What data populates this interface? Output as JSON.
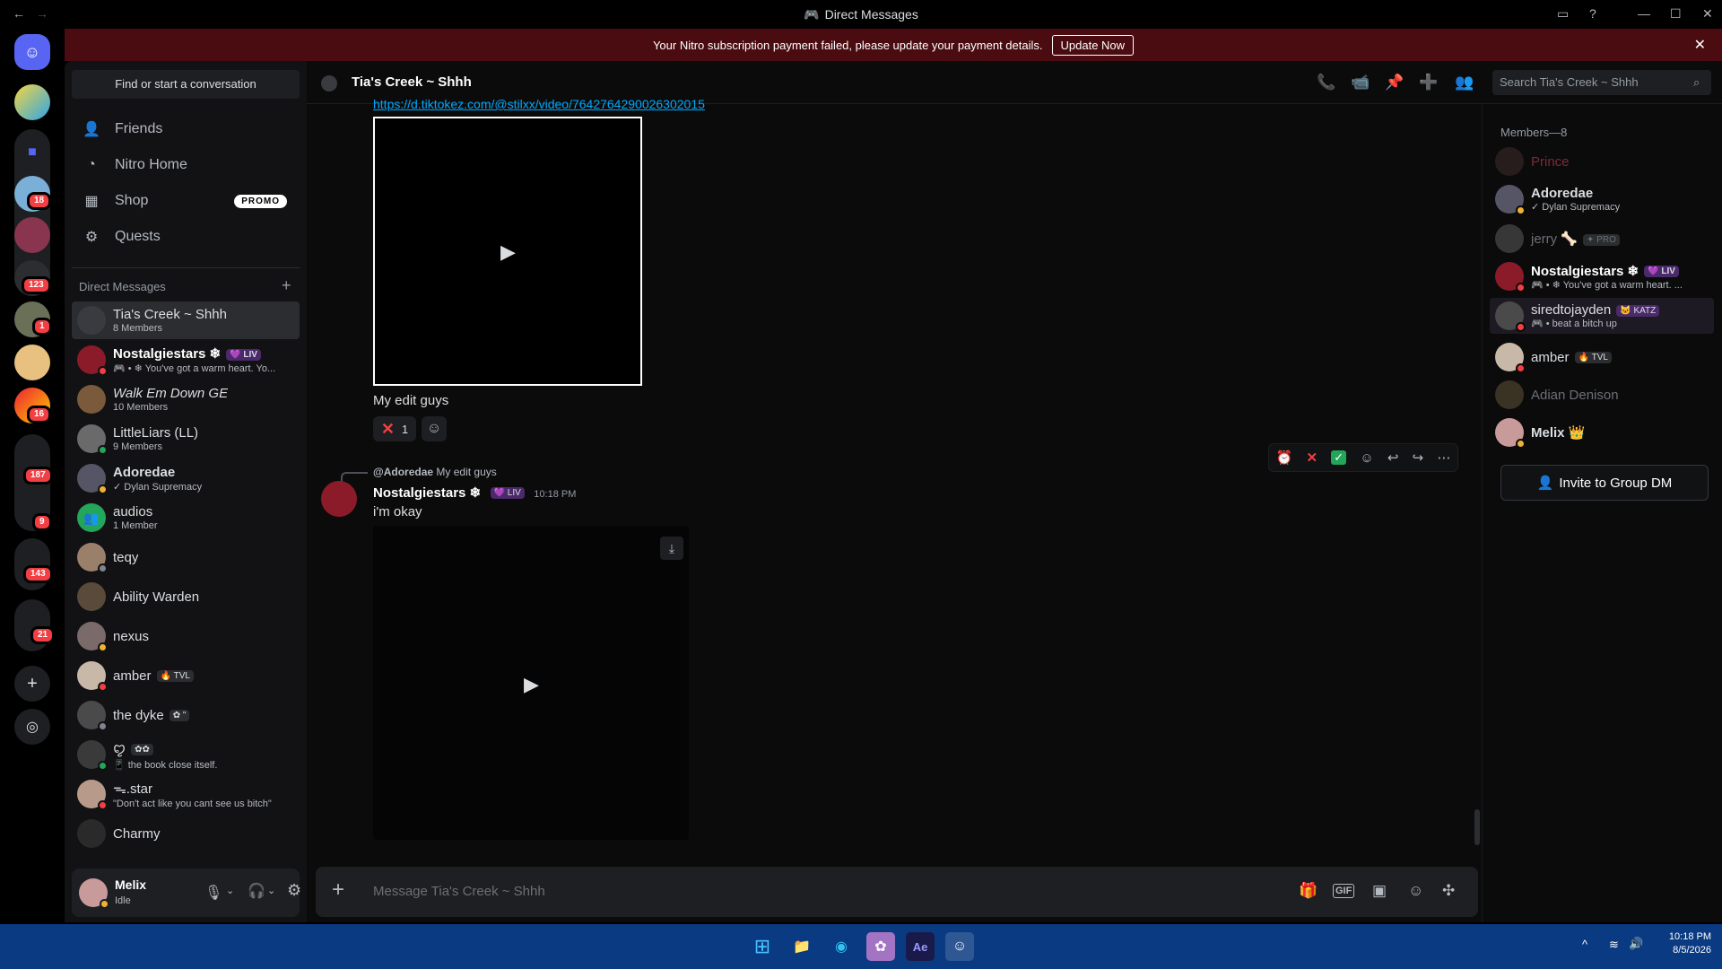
{
  "window": {
    "title": "Direct Messages",
    "back": "←",
    "forward": "→"
  },
  "banner": {
    "text": "Your Nitro subscription payment failed, please update your payment details.",
    "button": "Update Now"
  },
  "rail_badges": [
    "18",
    "123",
    "1",
    "16",
    "187",
    "9",
    "143",
    "21"
  ],
  "sidebar": {
    "find": "Find or start a conversation",
    "nav": [
      {
        "label": "Friends",
        "icon": "friends-icon"
      },
      {
        "label": "Nitro Home",
        "icon": "nitro-icon"
      },
      {
        "label": "Shop",
        "icon": "shop-icon",
        "badge": "PROMO"
      },
      {
        "label": "Quests",
        "icon": "quests-icon"
      }
    ],
    "dm_header": "Direct Messages",
    "dms": [
      {
        "name": "Tia's Creek ~ Shhh",
        "sub": "8 Members"
      },
      {
        "name": "Nostalgiestars ❄",
        "tag": "💜 LIV",
        "sub": "🎮 • ❄ You've got a warm heart. Yo..."
      },
      {
        "name": "Walk Em Down GE",
        "sub": "10 Members"
      },
      {
        "name": "LittleLiars (LL)",
        "sub": "9 Members"
      },
      {
        "name": "Adoredae",
        "sub": "✓ Dylan Supremacy"
      },
      {
        "name": "audios",
        "sub": "1 Member"
      },
      {
        "name": "teqy",
        "sub": ""
      },
      {
        "name": "Ability Warden",
        "sub": ""
      },
      {
        "name": "nexus",
        "sub": ""
      },
      {
        "name": "amber",
        "tag": "🔥 TVL",
        "sub": ""
      },
      {
        "name": "the dyke",
        "tag": "✿ \"",
        "sub": ""
      },
      {
        "name": "ꨄ",
        "tag": "✿✿",
        "sub": "📱 the book close itself."
      },
      {
        "name": "ᯓ.star",
        "sub": "\"Don't act like you cant see us bitch\""
      },
      {
        "name": "Charmy",
        "sub": ""
      }
    ],
    "user": {
      "name": "Melix",
      "status": "Idle"
    }
  },
  "chat": {
    "channel": "Tia's Creek ~ Shhh",
    "search_placeholder": "Search Tia's Creek ~ Shhh",
    "link": "https://d.tiktokez.com/@stilxx/video/7642764290026302015",
    "msg1_text": "My edit guys",
    "reaction_count": "1",
    "reply_ref": "@Adoredae",
    "reply_text": "My edit guys",
    "msg2_author": "Nostalgiestars ❄",
    "msg2_tag": "💜 LIV",
    "msg2_time": "10:18 PM",
    "msg2_text": "i'm okay",
    "composer_placeholder": "Message Tia's Creek ~ Shhh"
  },
  "members": {
    "header": "Members—8",
    "list": [
      {
        "name": "Prince",
        "sub": "",
        "color": "#7a2a3a"
      },
      {
        "name": "Adoredae",
        "sub": "✓ Dylan Supremacy",
        "color": "#dbdee1"
      },
      {
        "name": "jerry 🦴",
        "tag": "✦ PRO",
        "sub": "",
        "color": "#6d6f78"
      },
      {
        "name": "Nostalgiestars ❄",
        "tag": "💜 LIV",
        "sub": "🎮 • ❄ You've got a warm heart. ...",
        "color": "#ffffff"
      },
      {
        "name": "siredtojayden",
        "tag": "🐱 KATZ",
        "sub": "🎮 • beat a bitch up",
        "color": "#dbdee1"
      },
      {
        "name": "amber",
        "tag": "🔥 TVL",
        "sub": "",
        "color": "#dbdee1"
      },
      {
        "name": "Adian Denison",
        "sub": "",
        "color": "#6d6f78"
      },
      {
        "name": "Melix 👑",
        "sub": "",
        "color": "#dbdee1"
      }
    ],
    "invite": "Invite to Group DM"
  },
  "clock": {
    "time": "10:18 PM",
    "date": "8/5/2026"
  },
  "colors": {
    "accent": "#5865f2",
    "danger": "#f23f43",
    "banner": "#4a0c10",
    "taskbar": "#0a3a82"
  }
}
